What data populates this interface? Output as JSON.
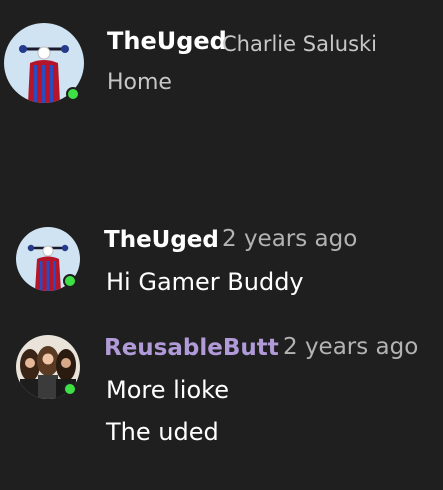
{
  "profile": {
    "gamertag": "TheUged",
    "real_name": "Charlie Saluski",
    "status": "Home"
  },
  "messages": [
    {
      "author": "TheUged",
      "time": "2 years ago",
      "lines": [
        "Hi Gamer Buddy"
      ]
    },
    {
      "author": "ReusableButt",
      "time": "2 years ago",
      "lines": [
        "More lioke",
        "The uded"
      ]
    }
  ],
  "colors": {
    "background": "#1f1f1f",
    "online": "#3fe046",
    "secondary_text": "#b3b3b3",
    "reusablebutt_name": "#b09ad8"
  },
  "icons": {
    "profile_avatar": "scooter-avatar-icon",
    "reusablebutt_avatar": "group-photo-avatar-icon",
    "presence": "online-presence-icon"
  }
}
